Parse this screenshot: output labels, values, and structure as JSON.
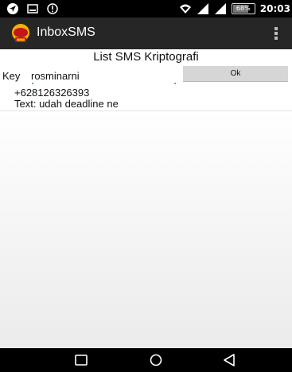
{
  "status_bar": {
    "left_icons": [
      "location-icon",
      "gallery-notification-icon",
      "alert-icon"
    ],
    "right_icons": [
      "wifi-icon",
      "signal-icon",
      "signal-icon-2",
      "battery-icon"
    ],
    "battery_level": "68%",
    "time": "20:03"
  },
  "action_bar": {
    "app_icon": "app-logo-icon",
    "title": "InboxSMS",
    "menu_icon": "overflow-menu-icon"
  },
  "main": {
    "page_title": "List SMS Kriptografi",
    "key": {
      "label": "Key",
      "value": "rosminarni"
    },
    "ok_button_label": "Ok",
    "messages": [
      {
        "sender": "+628126326393",
        "text": "Text: udah deadline ne"
      }
    ]
  },
  "nav_bar": {
    "icons": [
      "recent-apps-icon",
      "home-icon",
      "back-icon"
    ]
  },
  "colors": {
    "status_bar_bg": "#000000",
    "action_bar_bg": "#262626",
    "button_bg": "#d6d6d6",
    "accent": "#33b5e5"
  }
}
